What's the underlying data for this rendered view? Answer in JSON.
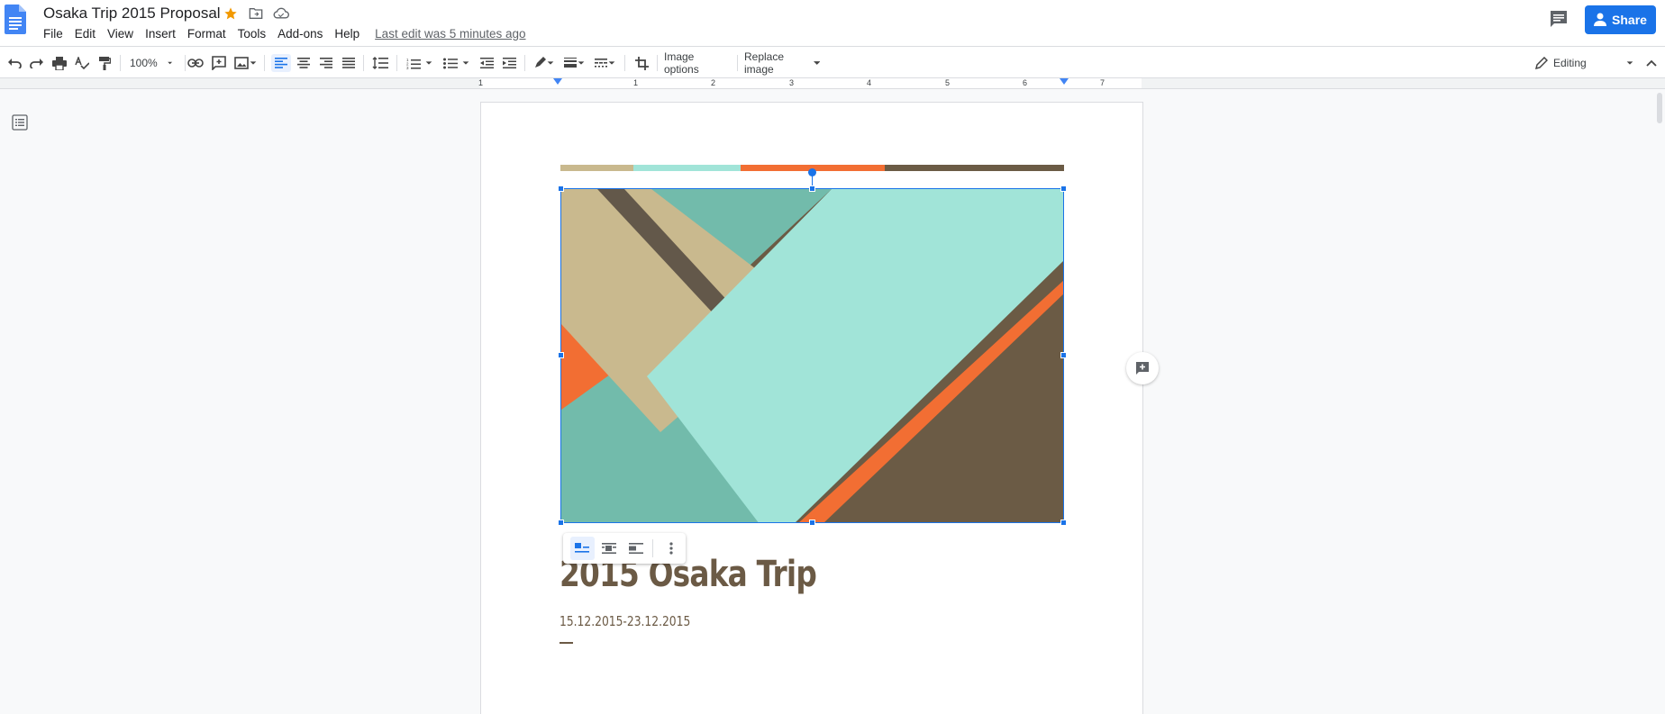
{
  "app": {
    "doc_title": "Osaka Trip 2015 Proposal",
    "menu": [
      "File",
      "Edit",
      "View",
      "Insert",
      "Format",
      "Tools",
      "Add-ons",
      "Help"
    ],
    "last_edit": "Last edit was 5 minutes ago",
    "share_label": "Share"
  },
  "toolbar": {
    "zoom": "100%",
    "image_options": "Image options",
    "replace_image": "Replace image",
    "mode": "Editing"
  },
  "ruler": {
    "numbers": [
      "1",
      "1",
      "2",
      "3",
      "4",
      "5",
      "6",
      "7"
    ]
  },
  "document": {
    "heading": "2015 Osaka Trip",
    "dates": "15.12.2015-23.12.2015",
    "color_strip": [
      "#c9b98e",
      "#a1e4d8",
      "#f26e33",
      "#6b5b45"
    ]
  },
  "colors": {
    "accent": "#1a73e8",
    "heading": "#6b5a45",
    "star": "#f29900"
  }
}
